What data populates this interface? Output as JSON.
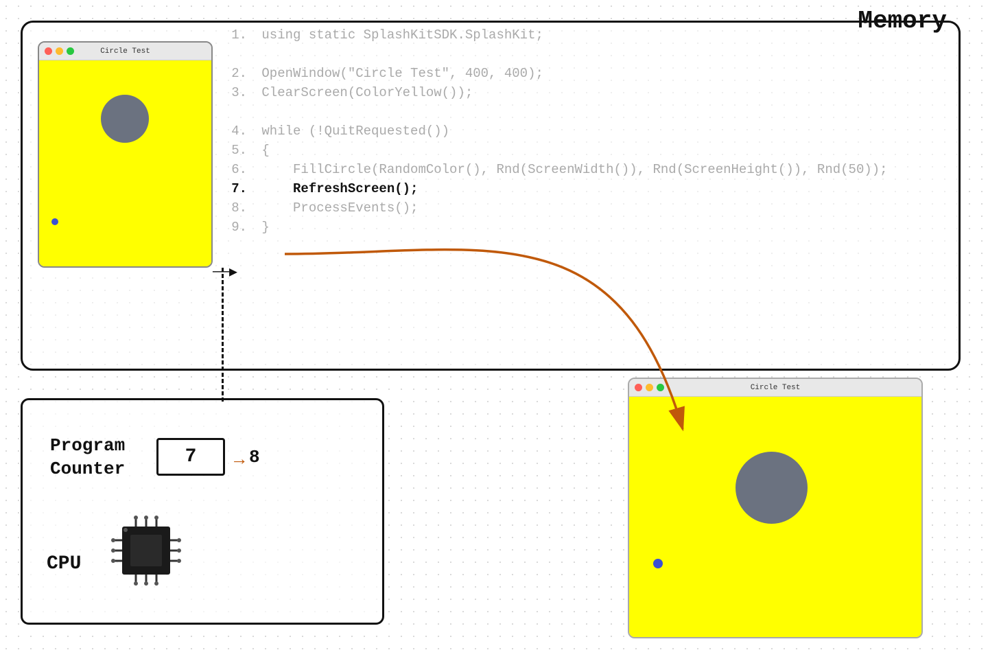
{
  "title": "Memory",
  "code_panel": {
    "lines": [
      {
        "num": "1.",
        "text": " using static SplashKitSDK.SplashKit;",
        "active": false,
        "blank_after": false
      },
      {
        "num": "",
        "text": "",
        "active": false,
        "blank_after": false
      },
      {
        "num": "2.",
        "text": " OpenWindow(\"Circle Test\", 400, 400);",
        "active": false,
        "blank_after": false
      },
      {
        "num": "3.",
        "text": " ClearScreen(ColorYellow());",
        "active": false,
        "blank_after": false
      },
      {
        "num": "",
        "text": "",
        "active": false,
        "blank_after": false
      },
      {
        "num": "4.",
        "text": " while (!QuitRequested())",
        "active": false,
        "blank_after": false
      },
      {
        "num": "5.",
        "text": " {",
        "active": false,
        "blank_after": false
      },
      {
        "num": "6.",
        "text": "    FillCircle(RandomColor(), Rnd(ScreenWidth()), Rnd(ScreenHeight()), Rnd(50));",
        "active": false,
        "blank_after": false
      },
      {
        "num": "7.",
        "text": "    RefreshScreen();",
        "active": true,
        "blank_after": false
      },
      {
        "num": "8.",
        "text": "    ProcessEvents();",
        "active": false,
        "blank_after": false
      },
      {
        "num": "9.",
        "text": " }",
        "active": false,
        "blank_after": false
      }
    ]
  },
  "mini_window_top": {
    "title": "Circle Test",
    "titlebar_buttons": [
      "red",
      "yellow",
      "green"
    ]
  },
  "mini_window_bottom": {
    "title": "Circle Test",
    "titlebar_buttons": [
      "red",
      "yellow",
      "green"
    ]
  },
  "cpu_panel": {
    "program_counter_label": "Program\nCounter",
    "pc_value": "7",
    "pc_next_value": "8",
    "cpu_label": "CPU"
  },
  "arrow_label": "→",
  "line7_indicator": "──▶"
}
